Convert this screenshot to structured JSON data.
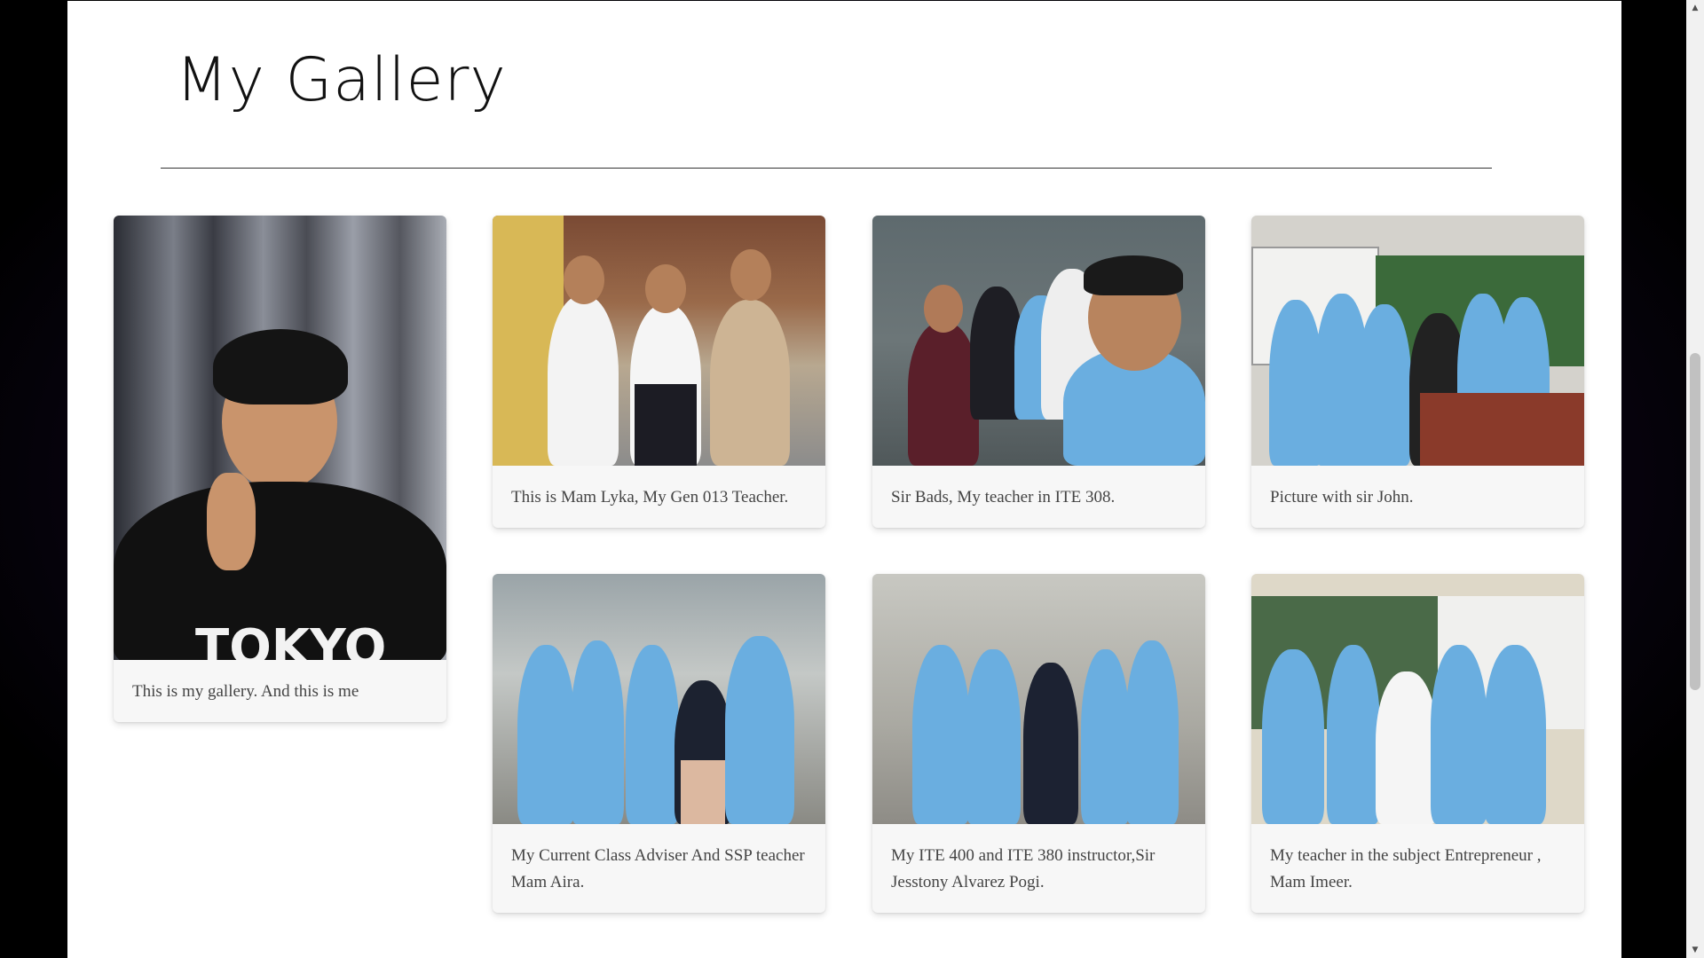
{
  "page": {
    "title": "My Gallery"
  },
  "gallery": {
    "items": [
      {
        "caption": "This is my gallery. And this is me",
        "icon": "portrait-photo"
      },
      {
        "caption": "This is Mam Lyka, My Gen 013 Teacher.",
        "icon": "group-photo"
      },
      {
        "caption": "Sir Bads, My teacher in ITE 308.",
        "icon": "selfie-group-photo"
      },
      {
        "caption": "Picture with sir John.",
        "icon": "classroom-group-photo"
      },
      {
        "caption": "My Current Class Adviser And SSP teacher Mam Aira.",
        "icon": "group-photo"
      },
      {
        "caption": "My ITE 400 and ITE 380 instructor,Sir Jesstony Alvarez Pogi.",
        "icon": "hallway-group-photo"
      },
      {
        "caption": "My teacher in the subject Entrepreneur , Mam Imeer.",
        "icon": "classroom-group-photo"
      }
    ]
  },
  "colors": {
    "uniform_blue": "#6aaee0",
    "page_background": "#ffffff",
    "outer_background": "#000000",
    "caption_text": "#444444",
    "card_background": "#f7f7f7"
  }
}
